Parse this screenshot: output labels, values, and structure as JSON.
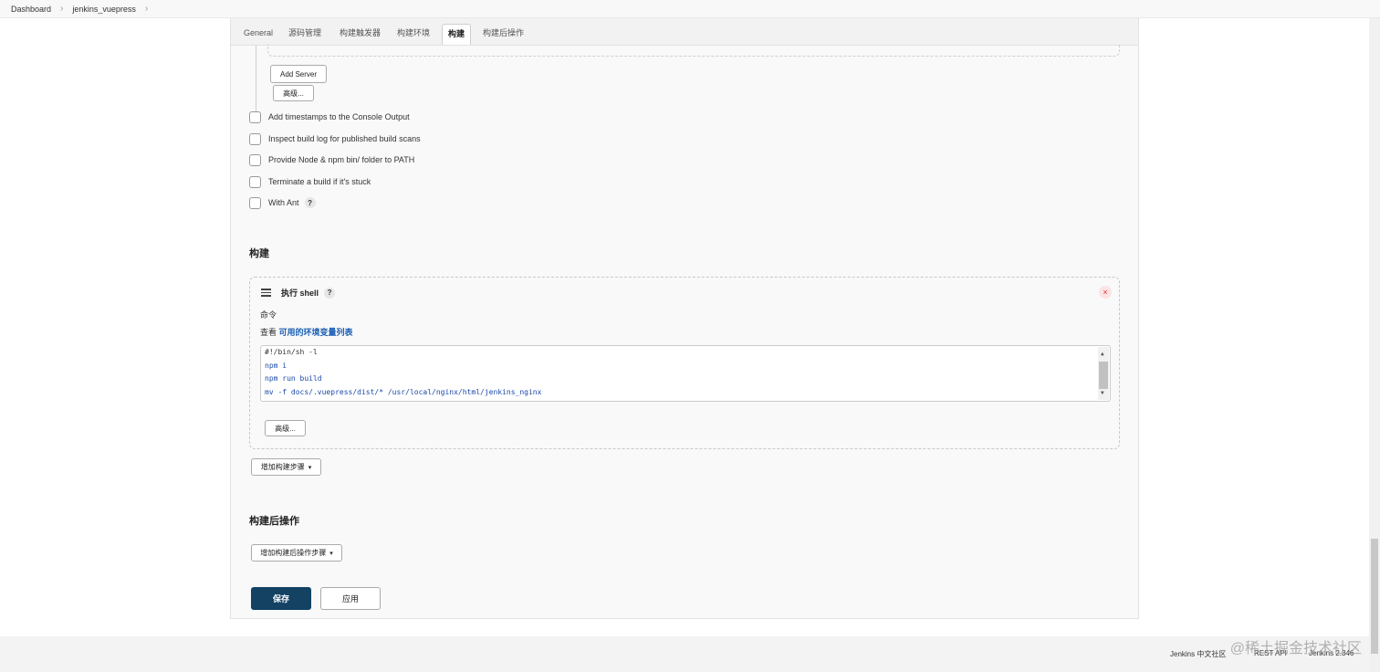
{
  "breadcrumb": {
    "items": [
      "Dashboard",
      "jenkins_vuepress"
    ],
    "separator": "›"
  },
  "tabs": [
    "General",
    "源码管理",
    "构建触发器",
    "构建环境",
    "构建",
    "构建后操作"
  ],
  "active_tab": "构建",
  "env_section": {
    "add_server_button": "Add Server",
    "advanced_button": "高级...",
    "checkboxes": [
      "Add timestamps to the Console Output",
      "Inspect build log for published build scans",
      "Provide Node & npm bin/ folder to PATH",
      "Terminate a build if it's stuck",
      "With Ant"
    ],
    "help_glyph": "?"
  },
  "build_section": {
    "title": "构建",
    "shell_step": {
      "title": "执行 shell",
      "help_glyph": "?",
      "close_glyph": "×",
      "command_label": "命令",
      "env_prefix": "查看 ",
      "env_link": "可用的环境变量列表",
      "code_lines": [
        "#!/bin/sh -l",
        "npm i",
        "npm run build",
        "mv -f docs/.vuepress/dist/* /usr/local/nginx/html/jenkins_nginx"
      ],
      "advanced_button": "高级..."
    },
    "add_step_button": "增加构建步骤"
  },
  "post_build_section": {
    "title": "构建后操作",
    "add_step_button": "增加构建后操作步骤"
  },
  "actions": {
    "save": "保存",
    "apply": "应用"
  },
  "footer": {
    "jenkins_community": "Jenkins 中文社区",
    "rest_api": "REST API",
    "version": "Jenkins 2.346"
  },
  "watermark": "@稀土掘金技术社区",
  "colors": {
    "primary": "#134263",
    "link": "#1a5fb4",
    "close_bg": "#fde3e3"
  }
}
